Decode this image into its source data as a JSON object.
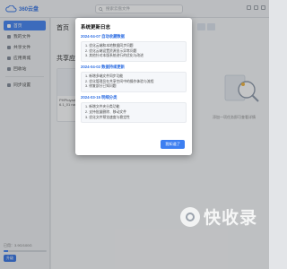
{
  "app": {
    "name": "360云盘"
  },
  "search": {
    "placeholder": "搜索云盘文件"
  },
  "sidebar": {
    "items": [
      {
        "label": "首页",
        "active": true
      },
      {
        "label": "我的文件"
      },
      {
        "label": "共享文件"
      },
      {
        "label": "应用商城"
      },
      {
        "label": "回收站"
      },
      {
        "label": "同步设置"
      }
    ],
    "storage_text": "已用：3.9G/100G",
    "upgrade_label": "升级"
  },
  "main": {
    "title": "首页",
    "section_title": "共享应用",
    "card_text": "PHPtoyadmin PHPtoyadmin 6.1_01 nat_..."
  },
  "empty_state": {
    "text": "添加一项任务即可查看详情"
  },
  "dialog": {
    "title": "系统更新日志",
    "versions": [
      {
        "label": "2024-04-07 自动收藏数据",
        "notes": [
          "1. 优化云端和本地数据同步问题",
          "2. 优化云端设置资源显示异常问题",
          "3. 其他针对本版系统进行的优化与改进"
        ]
      },
      {
        "label": "2024-04-02 数据持续更新",
        "notes": [
          "1. 新增多端文件同步功能",
          "2. 优化管理员在共享空间中的操作体验与流程",
          "3. 修复部分已知问题"
        ]
      },
      {
        "label": "2024-03-15 明细分类",
        "notes": [
          "1. 新增文件夹分类功能",
          "2. 支持批量删除、移动文件",
          "3. 优化文件预览速度与稳定性"
        ]
      }
    ],
    "confirm_label": "我知道了"
  },
  "watermark": {
    "text": "快收录"
  },
  "colors": {
    "accent": "#3d7ff1",
    "brand": "#2f6fe3"
  }
}
